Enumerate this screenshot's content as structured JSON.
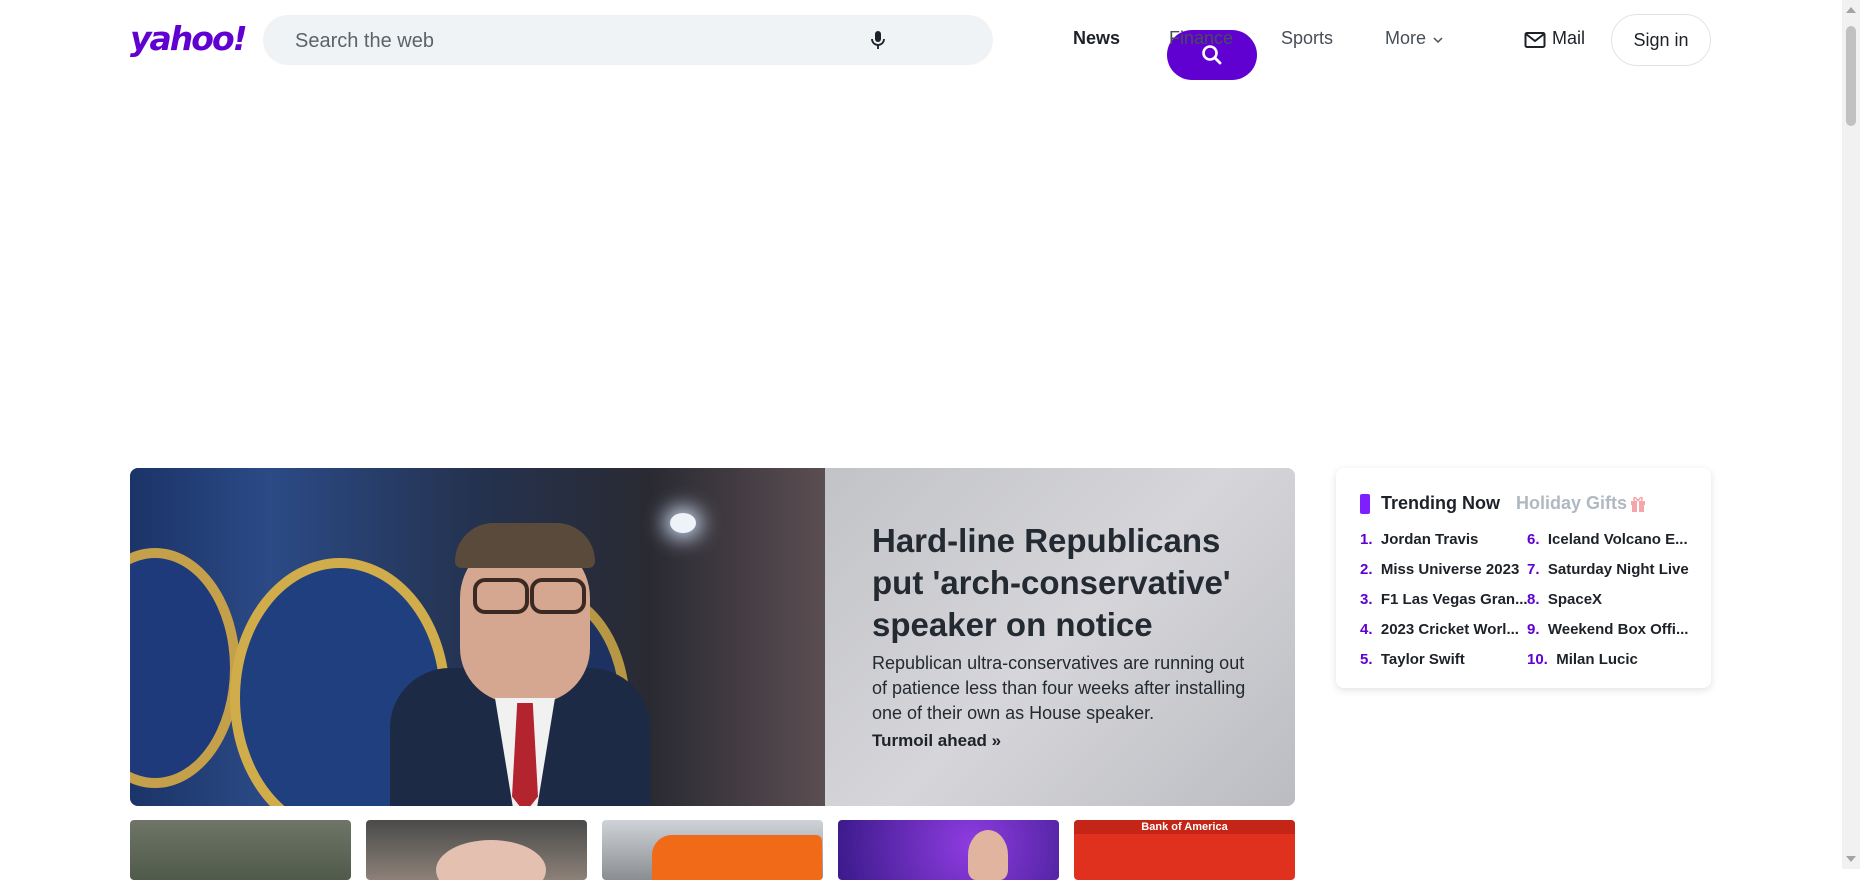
{
  "header": {
    "logo": "yahoo!",
    "search_placeholder": "Search the web",
    "nav": [
      "News",
      "Finance",
      "Sports",
      "More"
    ],
    "mail_label": "Mail",
    "signin_label": "Sign in"
  },
  "hero": {
    "title": "Hard-line Republicans put 'arch-conservative' speaker on notice",
    "description": "Republican ultra-conservatives are running out of patience less than four weeks after installing one of their own as House speaker.",
    "link": "Turmoil ahead »"
  },
  "trending": {
    "title": "Trending Now",
    "tab2": "Holiday Gifts",
    "items": [
      {
        "num": "1.",
        "label": "Jordan Travis"
      },
      {
        "num": "2.",
        "label": "Miss Universe 2023"
      },
      {
        "num": "3.",
        "label": "F1 Las Vegas Gran..."
      },
      {
        "num": "4.",
        "label": "2023 Cricket Worl..."
      },
      {
        "num": "5.",
        "label": "Taylor Swift"
      },
      {
        "num": "6.",
        "label": "Iceland Volcano E..."
      },
      {
        "num": "7.",
        "label": "Saturday Night Live"
      },
      {
        "num": "8.",
        "label": "SpaceX"
      },
      {
        "num": "9.",
        "label": "Weekend Box Offi..."
      },
      {
        "num": "10.",
        "label": "Milan Lucic"
      }
    ]
  },
  "thumbnails": {
    "thumb5_text": "Bank of America"
  },
  "colors": {
    "brand": "#6001d2",
    "trending_accent": "#7e1fff"
  }
}
